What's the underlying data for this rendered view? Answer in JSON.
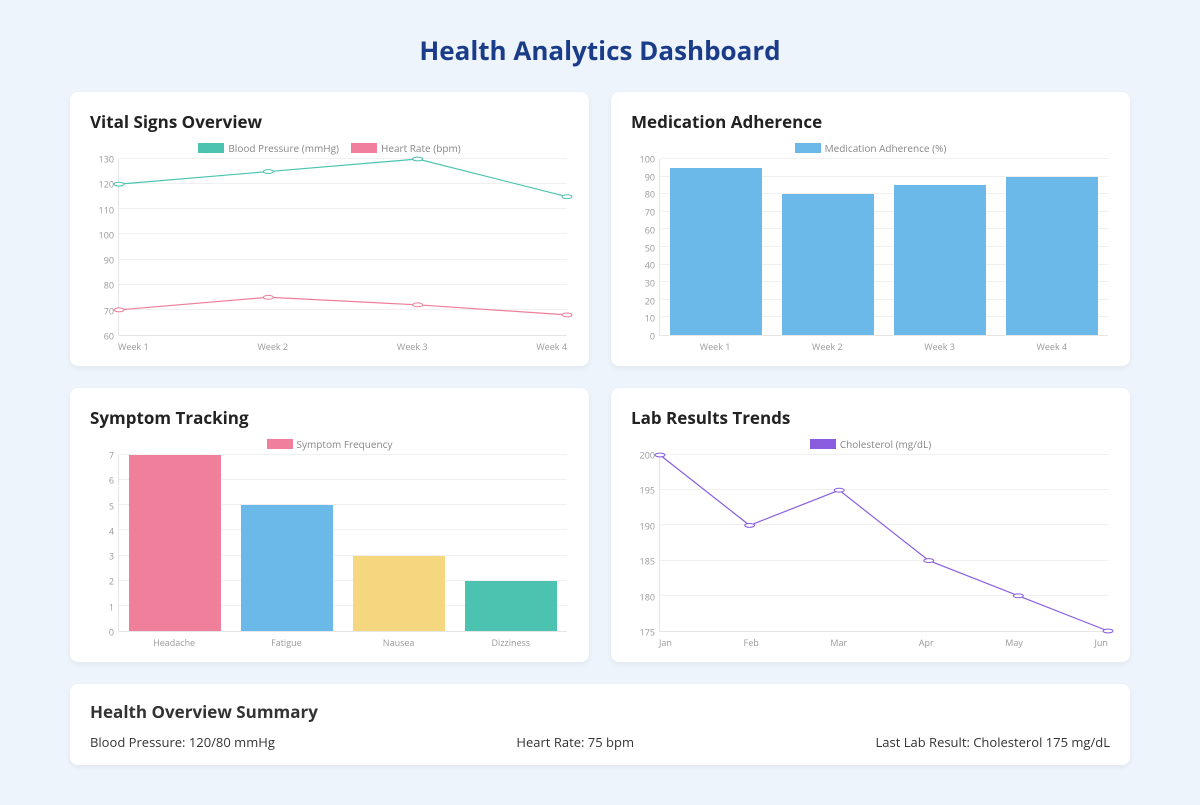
{
  "page": {
    "title": "Health Analytics Dashboard"
  },
  "cards": {
    "vitals": {
      "title": "Vital Signs Overview",
      "legend": [
        "Blood Pressure (mmHg)",
        "Heart Rate (bpm)"
      ]
    },
    "medication": {
      "title": "Medication Adherence",
      "legend": [
        "Medication Adherence (%)"
      ]
    },
    "symptoms": {
      "title": "Symptom Tracking",
      "legend": [
        "Symptom Frequency"
      ]
    },
    "labs": {
      "title": "Lab Results Trends",
      "legend": [
        "Cholesterol (mg/dL)"
      ]
    }
  },
  "summary": {
    "title": "Health Overview Summary",
    "bp": "Blood Pressure: 120/80 mmHg",
    "hr": "Heart Rate: 75 bpm",
    "lab": "Last Lab Result: Cholesterol 175 mg/dL"
  },
  "colors": {
    "teal": "#4cc3b0",
    "pink": "#f07f9b",
    "blue": "#6bb9e8",
    "yellow": "#f5d77f",
    "purple": "#8a5de0"
  },
  "chart_data": [
    {
      "id": "vitals",
      "type": "line",
      "title": "Vital Signs Overview",
      "categories": [
        "Week 1",
        "Week 2",
        "Week 3",
        "Week 4"
      ],
      "series": [
        {
          "name": "Blood Pressure (mmHg)",
          "values": [
            120,
            125,
            130,
            115
          ],
          "color": "#4cc3b0"
        },
        {
          "name": "Heart Rate (bpm)",
          "values": [
            70,
            75,
            72,
            68
          ],
          "color": "#f07f9b"
        }
      ],
      "ylim": [
        60,
        130
      ],
      "yticks": [
        60,
        70,
        80,
        90,
        100,
        110,
        120,
        130
      ],
      "xlabel": "",
      "ylabel": ""
    },
    {
      "id": "medication",
      "type": "bar",
      "title": "Medication Adherence",
      "categories": [
        "Week 1",
        "Week 2",
        "Week 3",
        "Week 4"
      ],
      "series": [
        {
          "name": "Medication Adherence (%)",
          "values": [
            95,
            80,
            85,
            90
          ],
          "color": "#6bb9e8"
        }
      ],
      "ylim": [
        0,
        100
      ],
      "yticks": [
        0,
        10,
        20,
        30,
        40,
        50,
        60,
        70,
        80,
        90,
        100
      ],
      "xlabel": "",
      "ylabel": ""
    },
    {
      "id": "symptoms",
      "type": "bar",
      "title": "Symptom Tracking",
      "categories": [
        "Headache",
        "Fatigue",
        "Nausea",
        "Dizziness"
      ],
      "series": [
        {
          "name": "Symptom Frequency",
          "values": [
            7,
            5,
            3,
            2
          ],
          "colors": [
            "#f07f9b",
            "#6bb9e8",
            "#f5d77f",
            "#4cc3b0"
          ]
        }
      ],
      "ylim": [
        0,
        7
      ],
      "yticks": [
        0,
        1,
        2,
        3,
        4,
        5,
        6,
        7
      ],
      "xlabel": "",
      "ylabel": ""
    },
    {
      "id": "labs",
      "type": "line",
      "title": "Lab Results Trends",
      "categories": [
        "Jan",
        "Feb",
        "Mar",
        "Apr",
        "May",
        "Jun"
      ],
      "series": [
        {
          "name": "Cholesterol (mg/dL)",
          "values": [
            200,
            190,
            195,
            185,
            180,
            175
          ],
          "color": "#8a5de0"
        }
      ],
      "ylim": [
        175,
        200
      ],
      "yticks": [
        175,
        180,
        185,
        190,
        195,
        200
      ],
      "xlabel": "",
      "ylabel": ""
    }
  ]
}
